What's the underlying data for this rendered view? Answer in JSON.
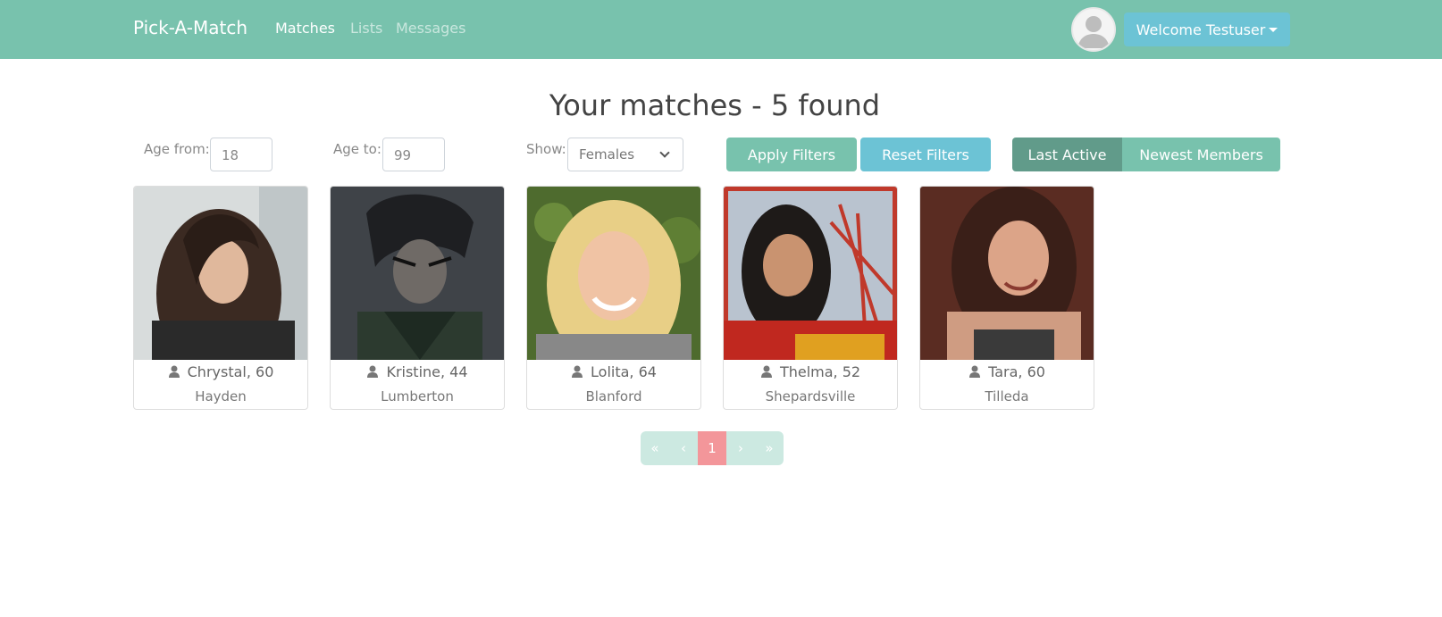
{
  "navbar": {
    "brand": "Pick-A-Match",
    "links": [
      {
        "label": "Matches",
        "active": true
      },
      {
        "label": "Lists",
        "active": false
      },
      {
        "label": "Messages",
        "active": false
      }
    ],
    "welcome_label": "Welcome Testuser"
  },
  "heading": "Your matches - 5 found",
  "filters": {
    "age_from_label": "Age from:",
    "age_from_value": "18",
    "age_to_label": "Age to:",
    "age_to_value": "99",
    "show_label": "Show:",
    "show_value": "Females",
    "apply_label": "Apply Filters",
    "reset_label": "Reset Filters",
    "sort_options": [
      {
        "label": "Last Active",
        "selected": true
      },
      {
        "label": "Newest Members",
        "selected": false
      }
    ]
  },
  "members": [
    {
      "name_age": "Chrystal, 60",
      "city": "Hayden"
    },
    {
      "name_age": "Kristine, 44",
      "city": "Lumberton"
    },
    {
      "name_age": "Lolita, 64",
      "city": "Blanford"
    },
    {
      "name_age": "Thelma, 52",
      "city": "Shepardsville"
    },
    {
      "name_age": "Tara, 60",
      "city": "Tilleda"
    }
  ],
  "pagination": {
    "first": "«",
    "prev": "‹",
    "current": "1",
    "next": "›",
    "last": "»"
  },
  "colors": {
    "primary": "#78c2ad",
    "info": "#6cc3d5",
    "secondary_active": "#619b8a",
    "pagination_active": "#f3969a"
  }
}
